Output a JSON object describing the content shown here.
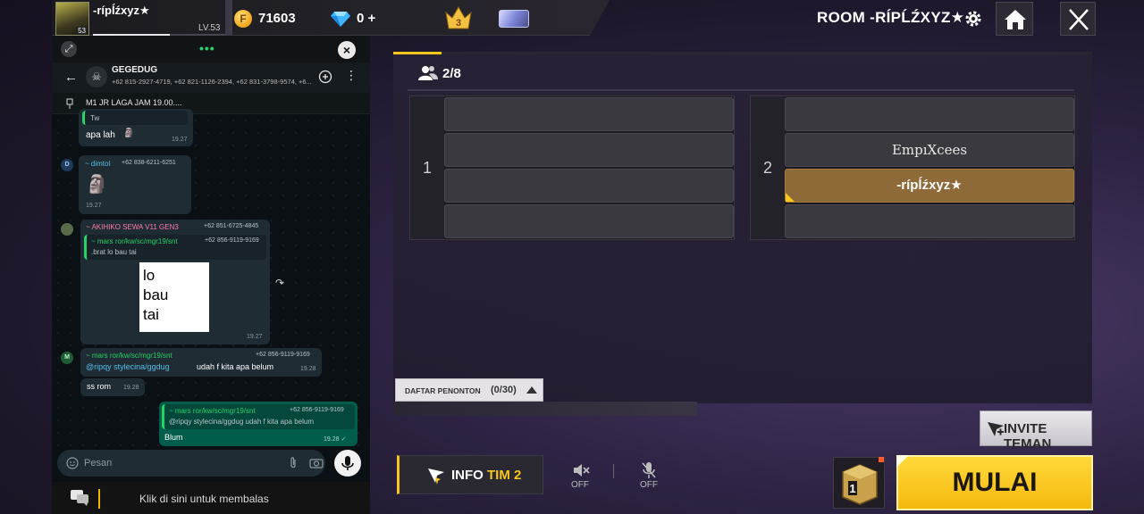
{
  "hud": {
    "player_name": "-rípĺźxyz★",
    "player_level": "LV.53",
    "avatar_level": "53",
    "xp_progress": 0.58,
    "gold": "71603",
    "diamonds": "0 +",
    "rank_badge": "3",
    "room_title": "ROOM -RÍPĹŹXYZ★"
  },
  "whatsapp": {
    "group_name": "GEGEDUG",
    "group_members": "+62 815-2927-4719, +62 821-1126-2394, +62 831-3798-9574, +6...",
    "pinned_message": "M1 JR LAGA JAM 19.00....",
    "messages": {
      "m1": {
        "quote": "Tw",
        "text": "apa lah",
        "time": "19.27"
      },
      "m2": {
        "avatar": "D",
        "sender": "~ dimtol",
        "phone": "+62 838-6211-6251",
        "time": "19.27"
      },
      "m3": {
        "sender": "~ AKIHIKO SEWA V11 GEN3",
        "phone": "+62 851-6725-4845",
        "quote_sender": "~ mars ror/kw/sc/mgr19/snt",
        "quote_phone": "+62 856-9119-9169",
        "quote_text": ".brat lo bau tai",
        "image_lines": [
          "lo",
          "bau",
          "tai"
        ],
        "time": "19.27"
      },
      "m4": {
        "avatar": "M",
        "sender": "~ mars ror/kw/sc/mgr19/snt",
        "phone": "+62 856-9119-9169",
        "mention": "@ripqy stylecina/ggdug",
        "text": "udah f kita apa belum",
        "time": "19.28"
      },
      "m5": {
        "text": "ss rom",
        "time": "19.28"
      },
      "m6": {
        "quote_sender": "~ mars ror/kw/sc/mgr19/snt",
        "quote_phone": "+62 856-9119-9169",
        "quote_text": "@ripqy stylecina/ggdug  udah f kita apa belum",
        "text": "Blum",
        "time": "19.28 ✓"
      }
    },
    "input_placeholder": "Pesan",
    "reply_prompt": "Klik di sini untuk membalas"
  },
  "room": {
    "players_count": "2/8",
    "team1": {
      "number": "1",
      "slots": [
        "",
        "",
        "",
        ""
      ]
    },
    "team2": {
      "number": "2",
      "slots": [
        "",
        "EmpıXcees",
        "-rípĺźxyz★",
        ""
      ]
    },
    "spectators_label": "DAFTAR PENONTON",
    "spectators_count": "(0/30)",
    "invite_label": "INVITE TEMAN",
    "info_label_prefix": "INFO",
    "info_label_accent": "TIM 2",
    "speaker_state": "OFF",
    "mic_state": "OFF",
    "box_label": "1",
    "start_label": "MULAI"
  },
  "colors": {
    "accent_yellow": "#f7c61d",
    "player_slot": "#8e6a39",
    "wa_green": "#25d366"
  },
  "icons": [
    "gold-coin-icon",
    "diamond-icon",
    "rank-badge-icon",
    "settings-icon",
    "home-icon",
    "close-icon",
    "players-icon",
    "invite-icon",
    "info-icon",
    "speaker-muted-icon",
    "mic-muted-icon",
    "box-icon"
  ]
}
